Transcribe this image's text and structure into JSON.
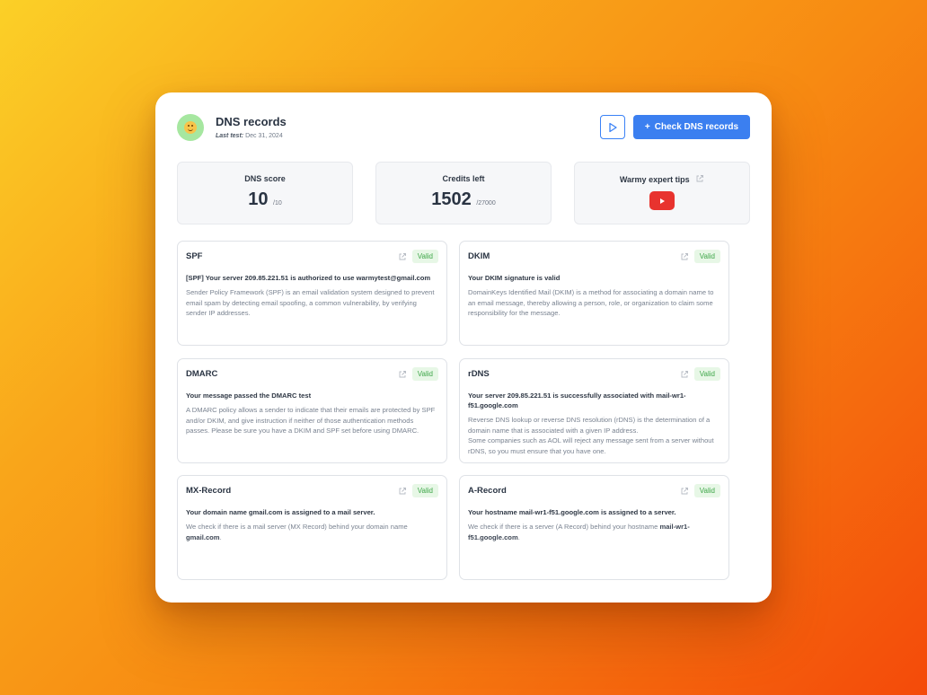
{
  "header": {
    "title": "DNS records",
    "last_test_label": "Last test:",
    "last_test_date": "Dec 31, 2024",
    "check_button_label": "Check DNS records",
    "check_button_icon": "+"
  },
  "stats": {
    "dns_score": {
      "label": "DNS score",
      "value": "10",
      "suffix": "/10"
    },
    "credits": {
      "label": "Credits left",
      "value": "1502",
      "suffix": "/27000"
    },
    "tips": {
      "label": "Warmy expert tips",
      "icon": "youtube-icon"
    }
  },
  "colors": {
    "accent": "#3b7ff0",
    "valid_bg": "#e7f7e6",
    "valid_text": "#3ea649",
    "youtube": "#e8332e"
  },
  "records": [
    {
      "title": "SPF",
      "status": "Valid",
      "headline": "[SPF] Your server 209.85.221.51 is authorized to use warmytest@gmail.com",
      "body": "Sender Policy Framework (SPF) is an email validation system designed to prevent email spam by detecting email spoofing, a common vulnerability, by verifying sender IP addresses."
    },
    {
      "title": "DKIM",
      "status": "Valid",
      "headline": "Your DKIM signature is valid",
      "body": "DomainKeys Identified Mail (DKIM) is a method for associating a domain name to an email message, thereby allowing a person, role, or organization to claim some responsibility for the message."
    },
    {
      "title": "DMARC",
      "status": "Valid",
      "headline": "Your message passed the DMARC test",
      "body": "A DMARC policy allows a sender to indicate that their emails are protected by SPF and/or DKIM, and give instruction if neither of those authentication methods passes. Please be sure you have a DKIM and SPF set before using DMARC."
    },
    {
      "title": "rDNS",
      "status": "Valid",
      "headline": "Your server 209.85.221.51 is successfully associated with mail-wr1-f51.google.com",
      "body": "Reverse DNS lookup or reverse DNS resolution (rDNS) is the determination of a domain name that is associated with a given IP address.",
      "body2": "Some companies such as AOL will reject any message sent from a server without rDNS, so you must ensure that you have one."
    },
    {
      "title": "MX-Record",
      "status": "Valid",
      "headline": "Your domain name gmail.com is assigned to a mail server.",
      "body": "We check if there is a mail server (MX Record) behind your domain name",
      "body_bold": "gmail.com",
      "body_end": "."
    },
    {
      "title": "A-Record",
      "status": "Valid",
      "headline": "Your hostname mail-wr1-f51.google.com is assigned to a server.",
      "body": "We check if there is a server (A Record) behind your hostname",
      "body_bold": "mail-wr1-f51.google.com",
      "body_end": "."
    }
  ]
}
